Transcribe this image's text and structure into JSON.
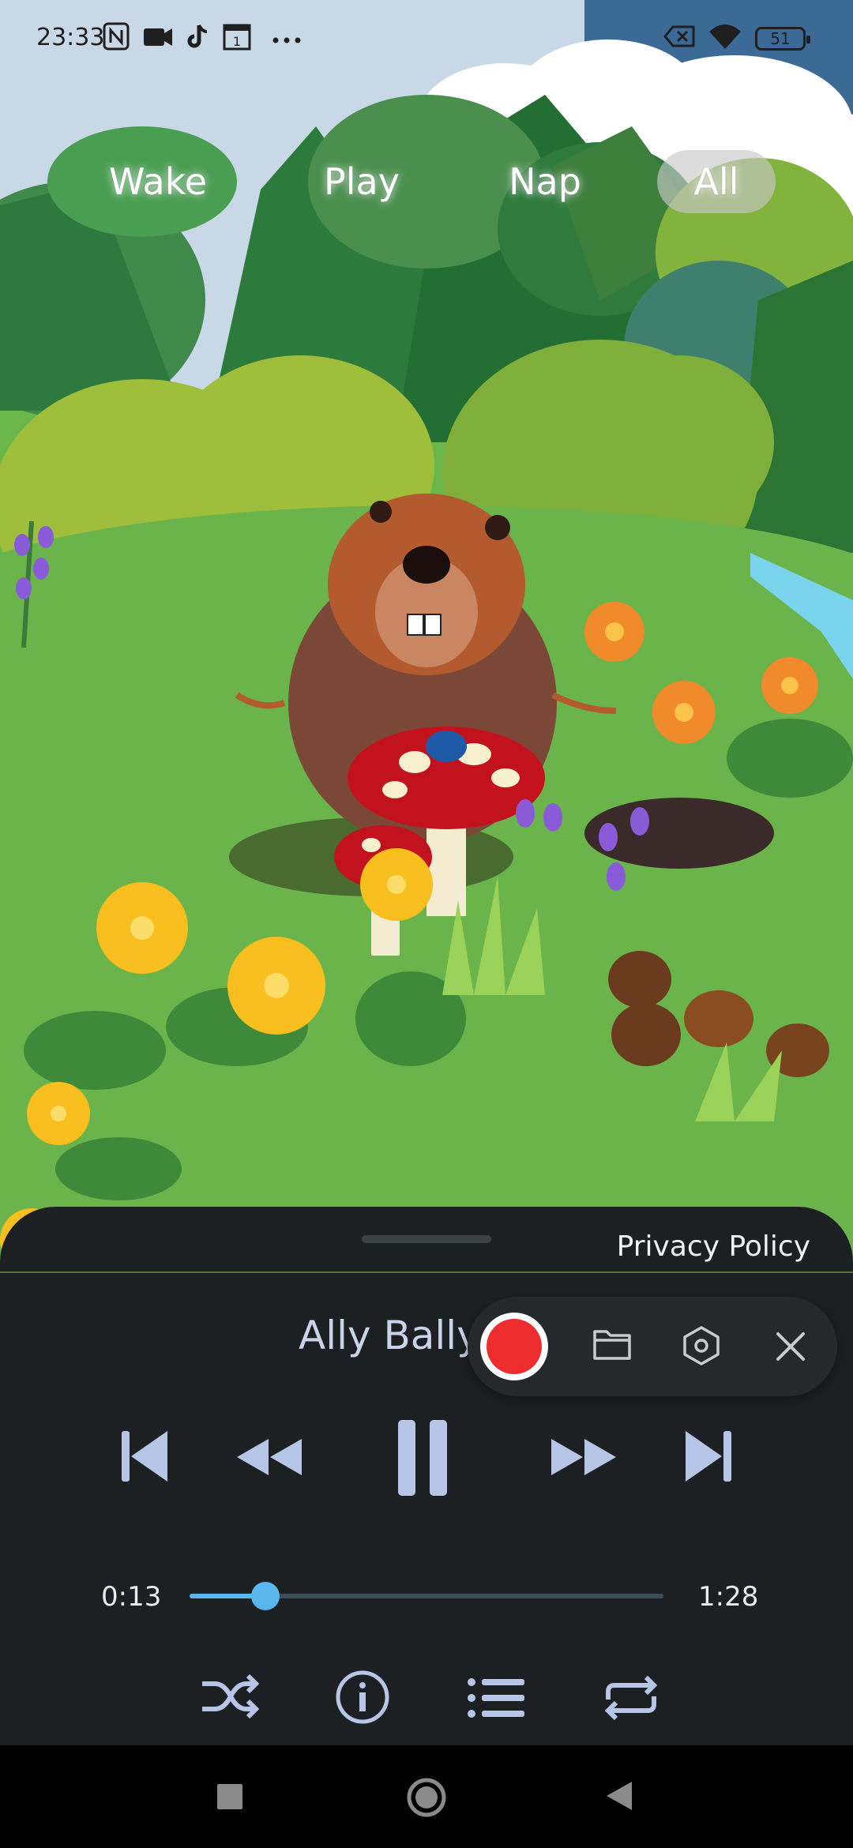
{
  "status_bar": {
    "time": "23:33",
    "battery": "51",
    "icons": [
      "nfc-icon",
      "video-camera-icon",
      "tiktok-icon",
      "calendar-icon",
      "more-icon",
      "sim-off-icon",
      "wifi-icon",
      "battery-icon"
    ]
  },
  "tabs": [
    {
      "label": "Wake",
      "active": false
    },
    {
      "label": "Play",
      "active": false
    },
    {
      "label": "Nap",
      "active": false
    },
    {
      "label": "All",
      "active": true
    }
  ],
  "panel": {
    "privacy_label": "Privacy Policy",
    "track_title": "Ally Bally",
    "elapsed": "0:13",
    "duration": "1:28",
    "progress": 0.16,
    "colors": {
      "panel": "#1d2022",
      "accent": "#5ab7ee",
      "controls": "#b7c6e6"
    }
  },
  "recorder": {
    "icons": [
      "record-icon",
      "folder-icon",
      "settings-hexagon-icon",
      "close-icon"
    ],
    "record_color": "#ee2d2e"
  },
  "nav_bar": {
    "icons": [
      "recents-square-icon",
      "home-circle-icon",
      "back-triangle-icon"
    ]
  }
}
